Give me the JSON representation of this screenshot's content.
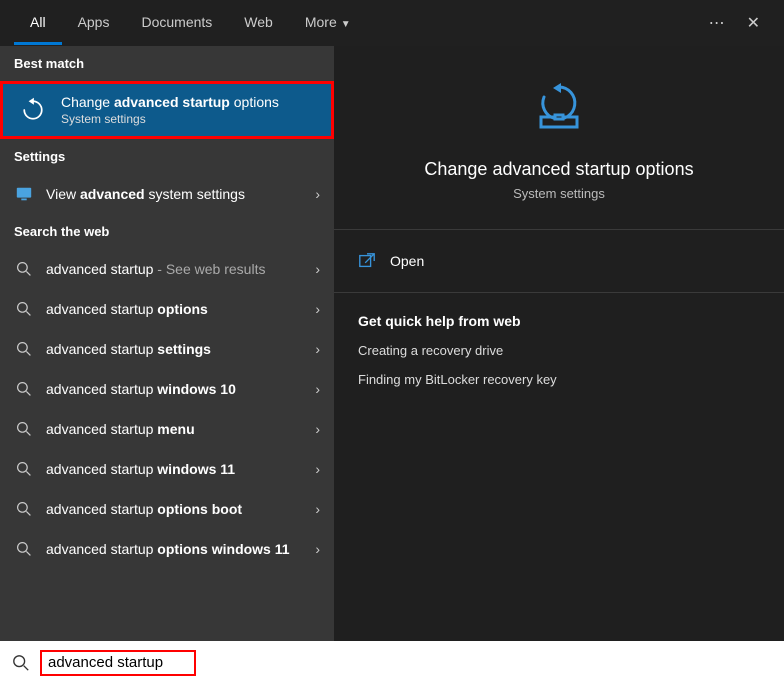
{
  "tabs": {
    "all": "All",
    "apps": "Apps",
    "documents": "Documents",
    "web": "Web",
    "more": "More"
  },
  "sections": {
    "best_match": "Best match",
    "settings": "Settings",
    "search_web": "Search the web"
  },
  "best_match": {
    "title_pre": "Change ",
    "title_bold": "advanced startup",
    "title_post": " options",
    "subtitle": "System settings"
  },
  "settings_item": {
    "pre": "View ",
    "bold": "advanced",
    "post": " system settings"
  },
  "web": [
    {
      "pre": "advanced startup",
      "bold": "",
      "post": "",
      "hint": " - See web results"
    },
    {
      "pre": "advanced startup ",
      "bold": "options",
      "post": "",
      "hint": ""
    },
    {
      "pre": "advanced startup ",
      "bold": "settings",
      "post": "",
      "hint": ""
    },
    {
      "pre": "advanced startup ",
      "bold": "windows 10",
      "post": "",
      "hint": ""
    },
    {
      "pre": "advanced startup ",
      "bold": "menu",
      "post": "",
      "hint": ""
    },
    {
      "pre": "advanced startup ",
      "bold": "windows 11",
      "post": "",
      "hint": ""
    },
    {
      "pre": "advanced startup ",
      "bold": "options boot",
      "post": "",
      "hint": ""
    },
    {
      "pre": "advanced startup ",
      "bold": "options windows 11",
      "post": "",
      "hint": ""
    }
  ],
  "preview": {
    "title": "Change advanced startup options",
    "subtitle": "System settings",
    "open": "Open",
    "help_header": "Get quick help from web",
    "help_links": [
      "Creating a recovery drive",
      "Finding my BitLocker recovery key"
    ]
  },
  "search": {
    "value": "advanced startup"
  },
  "colors": {
    "accent": "#0078d4",
    "highlight": "#ff0000"
  }
}
